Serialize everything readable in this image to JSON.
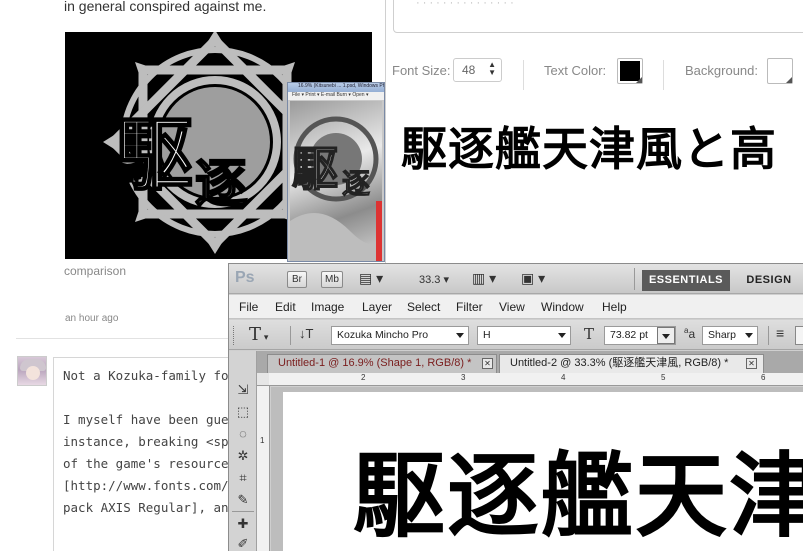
{
  "blog": {
    "intro_text": "in general conspired against me.",
    "emblem_glyph_1": "駆",
    "emblem_glyph_2": "逐",
    "caption": "comparison",
    "timestamp": "an hour ago",
    "comment_lines": [
      "Not a Kozuka-family fo",
      "",
      "I myself have been gue",
      "instance, breaking <sp",
      "of the game's resource",
      "[http://www.fonts.com/",
      "pack AXIS Regular], an"
    ]
  },
  "mini_window": {
    "title": "16.9% (Kitsunebi ... 1.psd, Windows Photo Viewer",
    "menu": "File ▾  Print ▾  E-mail  Burn ▾  Open ▾",
    "glyph_1": "駆",
    "glyph_2": "逐"
  },
  "editor": {
    "font_size_label": "Font Size:",
    "font_size_value": "48",
    "text_color_label": "Text Color:",
    "text_color": "#000000",
    "background_label": "Background:",
    "background_color": "#ffffff",
    "preview_text": "駆逐艦天津風と高"
  },
  "photoshop": {
    "logo": "Ps",
    "appbar": {
      "bridge_label": "Br",
      "minibridge_label": "Mb",
      "zoom": "33.3",
      "essentials": "ESSENTIALS",
      "design": "DESIGN"
    },
    "menus": [
      "File",
      "Edit",
      "Image",
      "Layer",
      "Select",
      "Filter",
      "View",
      "Window",
      "Help"
    ],
    "options": {
      "tool_glyph": "T",
      "font_family": "Kozuka Mincho Pro",
      "font_style": "H",
      "font_size": "73.82 pt",
      "aa_glyph": "a",
      "antialias": "Sharp"
    },
    "tabs": [
      {
        "label": "Untitled-1 @ 16.9% (Shape 1, RGB/8) *",
        "active": false
      },
      {
        "label": "Untitled-2 @ 33.3% (駆逐艦天津風, RGB/8) *",
        "active": true
      }
    ],
    "ruler_h": [
      "2",
      "3",
      "4",
      "5",
      "6"
    ],
    "ruler_v": [
      "1"
    ],
    "canvas_text": "駆逐艦天津"
  },
  "colors": {
    "ps_active_ws": "#5a5a5a",
    "ps_tab_inactive": "#c4c4c4",
    "ps_tab_active": "#e9e9e9",
    "ps_tab_text": "#7a1d1d"
  }
}
